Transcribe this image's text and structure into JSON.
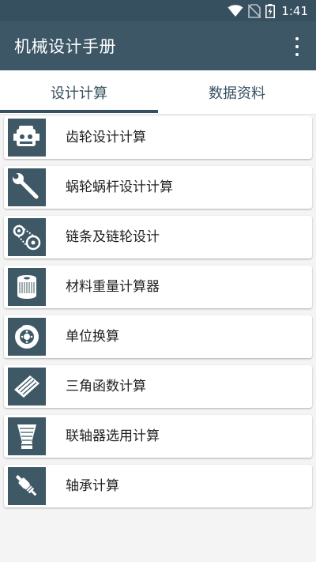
{
  "status_bar": {
    "time": "1:41"
  },
  "app_bar": {
    "title": "机械设计手册"
  },
  "tabs": [
    {
      "label": "设计计算",
      "selected": true
    },
    {
      "label": "数据资料",
      "selected": false
    }
  ],
  "items": [
    {
      "label": "齿轮设计计算",
      "icon": "gear-engine-icon"
    },
    {
      "label": "蜗轮蜗杆设计计算",
      "icon": "wrench-icon"
    },
    {
      "label": "链条及链轮设计",
      "icon": "chain-sprocket-icon"
    },
    {
      "label": "材料重量计算器",
      "icon": "filter-canister-icon"
    },
    {
      "label": "单位换算",
      "icon": "brake-disc-icon"
    },
    {
      "label": "三角函数计算",
      "icon": "air-filter-panel-icon"
    },
    {
      "label": "联轴器选用计算",
      "icon": "cone-filter-icon"
    },
    {
      "label": "轴承计算",
      "icon": "spark-plug-icon"
    }
  ],
  "colors": {
    "primary": "#3d5766",
    "status_bar": "#37505f",
    "icon_bg": "#3e5866",
    "background": "#f4f4f4"
  }
}
